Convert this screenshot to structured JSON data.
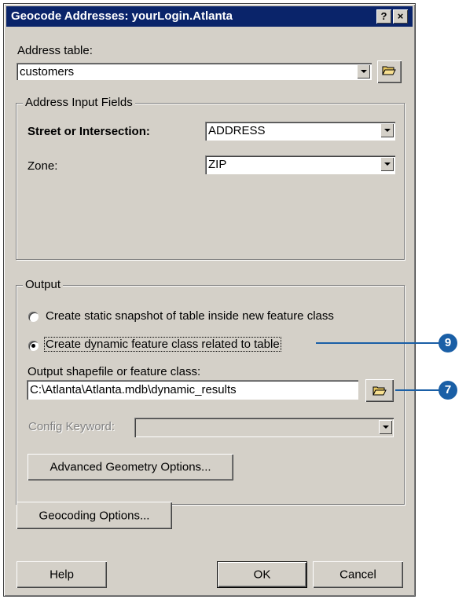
{
  "dialog": {
    "title": "Geocode Addresses: yourLogin.Atlanta",
    "help_glyph": "?",
    "close_glyph": "×"
  },
  "address_table": {
    "label": "Address table:",
    "value": "customers"
  },
  "input_fields": {
    "group_label": "Address Input Fields",
    "street_label": "Street or Intersection:",
    "street_value": "ADDRESS",
    "zone_label": "Zone:",
    "zone_value": "ZIP"
  },
  "output": {
    "group_label": "Output",
    "radio_static": "Create static snapshot of table inside new feature class",
    "radio_dynamic": "Create dynamic feature class related to table",
    "selected": "dynamic",
    "shapefile_label": "Output shapefile or feature class:",
    "shapefile_value": "C:\\Atlanta\\Atlanta.mdb\\dynamic_results",
    "config_label": "Config Keyword:",
    "config_value": "",
    "advanced_button": "Advanced Geometry Options..."
  },
  "geocoding_options_button": "Geocoding Options...",
  "footer": {
    "help": "Help",
    "ok": "OK",
    "cancel": "Cancel"
  },
  "callouts": {
    "first": "9",
    "second": "7"
  },
  "colors": {
    "titlebar": "#0a246a",
    "dialog_face": "#d4d0c8",
    "callout": "#1a5fa6"
  }
}
